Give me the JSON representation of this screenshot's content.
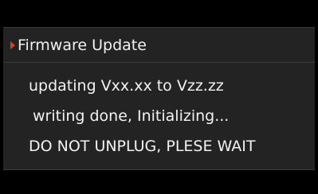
{
  "dialog": {
    "title": "Firmware Update",
    "marker_icon": "triangle-right-icon",
    "accent_color": "#e0401f",
    "lines": [
      "updating  Vxx.xx to Vzz.zz",
      "writing done, Initializing...",
      "DO NOT UNPLUG, PLESE WAIT"
    ]
  }
}
